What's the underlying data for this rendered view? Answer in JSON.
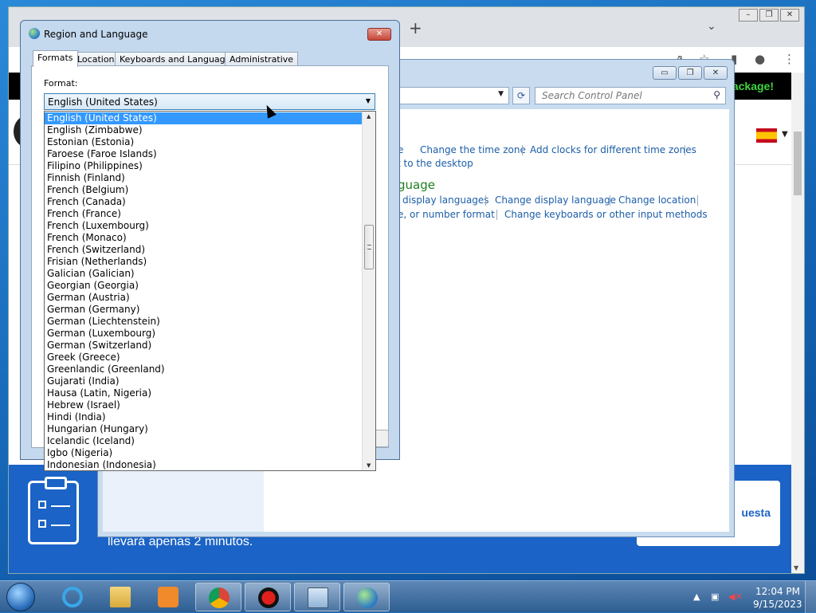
{
  "chrome": {
    "new_tab_glyph": "+",
    "tab_menu_glyph": "⌄",
    "promo_text": "package!",
    "band_text": "llevará apenas 2 minutos.",
    "cta_text": "uesta"
  },
  "control_panel": {
    "search_placeholder": "Search Control Panel",
    "links": {
      "frag_e": "e",
      "change_time_zone": "Change the time zone",
      "add_clocks": "Add clocks for different time zones",
      "to_desktop": "t to the desktop",
      "display_languages": "display languages",
      "change_display_language": "Change display language",
      "change_location": "Change location",
      "number_format": "e, or number format",
      "change_keyboards": "Change keyboards or other input methods"
    },
    "heading_fragment": "guage"
  },
  "dialog": {
    "title": "Region and Language",
    "tabs": [
      "Formats",
      "Location",
      "Keyboards and Languages",
      "Administrative"
    ],
    "format_label": "Format:",
    "format_value": "English (United States)",
    "options": [
      "English (United States)",
      "English (Zimbabwe)",
      "Estonian (Estonia)",
      "Faroese (Faroe Islands)",
      "Filipino (Philippines)",
      "Finnish (Finland)",
      "French (Belgium)",
      "French (Canada)",
      "French (France)",
      "French (Luxembourg)",
      "French (Monaco)",
      "French (Switzerland)",
      "Frisian (Netherlands)",
      "Galician (Galician)",
      "Georgian (Georgia)",
      "German (Austria)",
      "German (Germany)",
      "German (Liechtenstein)",
      "German (Luxembourg)",
      "German (Switzerland)",
      "Greek (Greece)",
      "Greenlandic (Greenland)",
      "Gujarati (India)",
      "Hausa (Latin, Nigeria)",
      "Hebrew (Israel)",
      "Hindi (India)",
      "Hungarian (Hungary)",
      "Icelandic (Iceland)",
      "Igbo (Nigeria)",
      "Indonesian (Indonesia)"
    ],
    "selected_index": 0
  },
  "taskbar": {
    "apps": [
      "internet-explorer",
      "file-explorer",
      "media-player",
      "chrome",
      "recorder",
      "control-panel",
      "region-language"
    ],
    "time": "12:04 PM",
    "date": "9/15/2023"
  },
  "colors": {
    "selection": "#3399ff",
    "link": "#1c5ea8",
    "heading": "#1e7d1e",
    "promo": "#3fd63f"
  }
}
